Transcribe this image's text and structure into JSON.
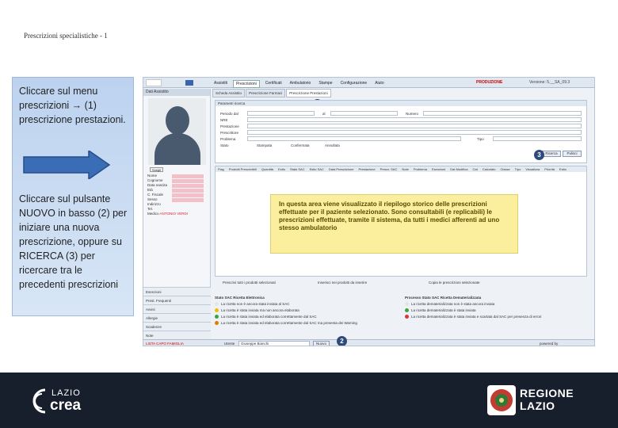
{
  "slide": {
    "title": "Prescrizioni specialistiche - 1",
    "instruction_1": "Cliccare sul menu prescrizioni → (1) prescrizione prestazioni.",
    "instruction_2": "Cliccare sul pulsante NUOVO in basso (2) per iniziare una nuova prescrizione, oppure su RICERCA (3) per ricercare tra le precedenti prescrizioni"
  },
  "app": {
    "menu": [
      "Assistiti",
      "Prescrizioni",
      "Certificati",
      "Ambulatorio",
      "Stampe",
      "Configurazione",
      "Aiuto"
    ],
    "active_menu": "Prescrizioni",
    "env_label": "PRODUZIONE",
    "version": "Versione: 5.__SA_09.3",
    "left_panel_header": "Dati Assistito",
    "select_button": "Scegli",
    "patient_fields": [
      "Nome",
      "Cognome",
      "Data nascita",
      "Età",
      "C. Fiscale",
      "Sesso",
      "Indirizzo",
      "Tel.",
      "Medico"
    ],
    "doctor_name": "ANTONIO VERDI",
    "left_nav": [
      "Esenzioni",
      "Prest. Frequenti",
      "Avvisi",
      "Allergie",
      "Scadenze",
      "Note"
    ],
    "tabs": [
      "Scheda Assistito",
      "Prescrizione Farmaci",
      "Prescrizione Prestazioni"
    ],
    "search": {
      "header": "Parametri ricerca",
      "labels": [
        "Periodo dal",
        "NRE",
        "Prestazione",
        "Prescrittore",
        "Problema",
        "Stato"
      ],
      "al_label": "al",
      "numero_label": "Numero",
      "tipo_label": "Tipo",
      "status_options": [
        "Stampata",
        "Confermata",
        "Annullata"
      ],
      "search_button": "Ricerca",
      "reset_button": "Pulisci"
    },
    "grid_columns": [
      "Flag",
      "Prodotti Prescrivibili",
      "Quantità",
      "Esito",
      "Stato SAC",
      "Esito SAC",
      "Data Prescrizione",
      "Prestazione",
      "Prescr. SAC",
      "Note",
      "Problema",
      "Esenzioni",
      "Dat Modifica",
      "Cat",
      "Calcolato",
      "Classe",
      "Tipo",
      "Visualizza",
      "Priorità",
      "Esito"
    ],
    "info_note": "In questa area viene visualizzato il riepilogo storico delle prescrizioni effettuate per il paziente selezionato. Sono consultabili (e replicabili) le prescrizioni effettuate, tramite il sistema, da tutti i medici afferenti ad uno stesso ambulatorio",
    "action_links": [
      "Prescrivi tutti i prodotti selezionati",
      "Inserisci nei prodotti da inserire",
      "Copia le prescrizioni selezionate"
    ],
    "legend_sac_title": "Stato SAC Ricetta Elettronica",
    "legend_sac": [
      "La ricetta non è ancora stata inviata al SAC",
      "La ricetta è stata inviata ma non ancora elaborata",
      "La ricetta è stata inviata ed elaborata correttamente dal SAC",
      "La ricetta è stata inviata ed elaborata correttamente dal SAC ma presenta dei Warning"
    ],
    "legend_dem_title": "Processo Stato SAC Ricetta Dematerializzata",
    "legend_dem": [
      "La ricetta dematerializzata non è stata ancora inviata",
      "La ricetta dematerializzata è stata inviata",
      "La ricetta dematerializzata è stata inviata e scartata dal SAC per presenza di errori"
    ],
    "bottom_status": "LISTA CAPO FAMIGLIA",
    "user_label": "Utente",
    "user_value": "Giuseppe Bianchi",
    "new_button": "Nuovo",
    "powered_by": "powered by",
    "badges": [
      "1",
      "2",
      "3"
    ],
    "colors": {
      "accent": "#2e4a78",
      "note_bg": "#fbef9e",
      "production": "#cc0000"
    }
  },
  "footer": {
    "brand_left_line1": "LAZIO",
    "brand_left_line2": "crea",
    "brand_right_line1": "REGIONE",
    "brand_right_line2": "LAZIO",
    "background": "#171f2c"
  }
}
